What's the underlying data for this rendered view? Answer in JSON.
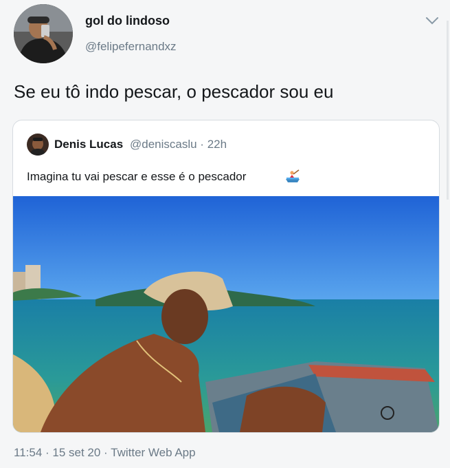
{
  "tweet": {
    "author": {
      "display_name": "gol do lindoso",
      "handle": "@felipefernandxz",
      "avatar_icon": "profile-photo"
    },
    "text": "Se eu tô indo pescar, o pescador sou eu",
    "menu_icon": "chevron-down-icon",
    "quoted": {
      "author_name": "Denis Lucas",
      "author_meta": "@deniscaslu · 22h",
      "text": "Imagina tu vai pescar e esse é o pescador",
      "emoji_icon": "rowboat-emoji",
      "photo_icon": "beach-photo"
    },
    "footer": "11:54 · 15 set 20 · Twitter Web App"
  },
  "colors": {
    "background": "#f5f6f7",
    "text_primary": "#14171a",
    "text_secondary": "#6b7a87",
    "card_border": "#d6dbe0"
  }
}
